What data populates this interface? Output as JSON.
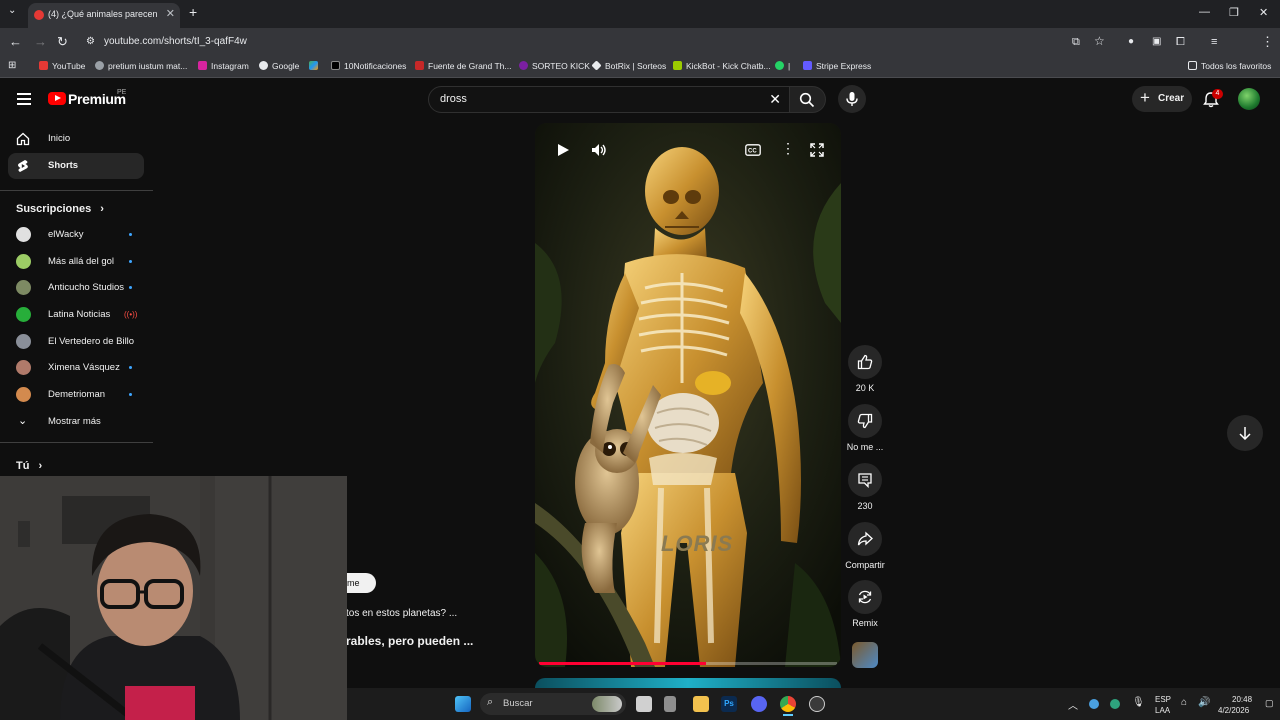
{
  "browser": {
    "tab_title": "(4) ¿Qué animales parecen ado...",
    "url": "youtube.com/shorts/tI_3-qafF4w",
    "bookmarks": [
      "YouTube",
      "pretium iustum mat...",
      "Instagram",
      "Google",
      "10Notificaciones",
      "Fuente de Grand Th...",
      "SORTEO KICK",
      "BotRix | Sorteos",
      "KickBot - Kick Chatb...",
      "Stripe Express"
    ],
    "bookmark_separator": "|",
    "all_bookmarks": "Todos los favoritos"
  },
  "header": {
    "logo": "Premium",
    "logo_region": "PE",
    "search_value": "dross",
    "create_label": "Crear",
    "notification_count": "4"
  },
  "sidebar": {
    "main": [
      {
        "label": "Inicio",
        "icon": "home-icon"
      },
      {
        "label": "Shorts",
        "icon": "shorts-icon"
      }
    ],
    "subscriptions_title": "Suscripciones",
    "subscriptions": [
      {
        "label": "elWacky",
        "status": "new",
        "color": "#e0e0e0"
      },
      {
        "label": "Más allá del gol",
        "status": "new",
        "color": "#9ccc65"
      },
      {
        "label": "Anticucho Studios",
        "status": "new",
        "color": "#7d8a63"
      },
      {
        "label": "Latina Noticias",
        "status": "live",
        "color": "#27ae3a"
      },
      {
        "label": "El Vertedero de Billo",
        "status": "none",
        "color": "#8a8f99"
      },
      {
        "label": "Ximena Vásquez",
        "status": "new",
        "color": "#b07a6a"
      },
      {
        "label": "Demetrioman",
        "status": "new",
        "color": "#d38a4e"
      }
    ],
    "show_more": "Mostrar más",
    "you_title": "Tú",
    "live_symbol": "((•))"
  },
  "short": {
    "overlay_text": "LORIS",
    "progress_fraction": 0.56
  },
  "actions": {
    "like_count": "20 K",
    "dislike_label": "No me ...",
    "comments_count": "230",
    "share_label": "Compartir",
    "remix_label": "Remix"
  },
  "partial_content": {
    "chip": "rme",
    "line1": "tos en estos planetas? ...",
    "line2": "rables, pero pueden ..."
  },
  "taskbar": {
    "search_placeholder": "Buscar",
    "lang_top": "ESP",
    "lang_bottom": "LAA",
    "time": "20:48",
    "date": "4/2/2026"
  }
}
